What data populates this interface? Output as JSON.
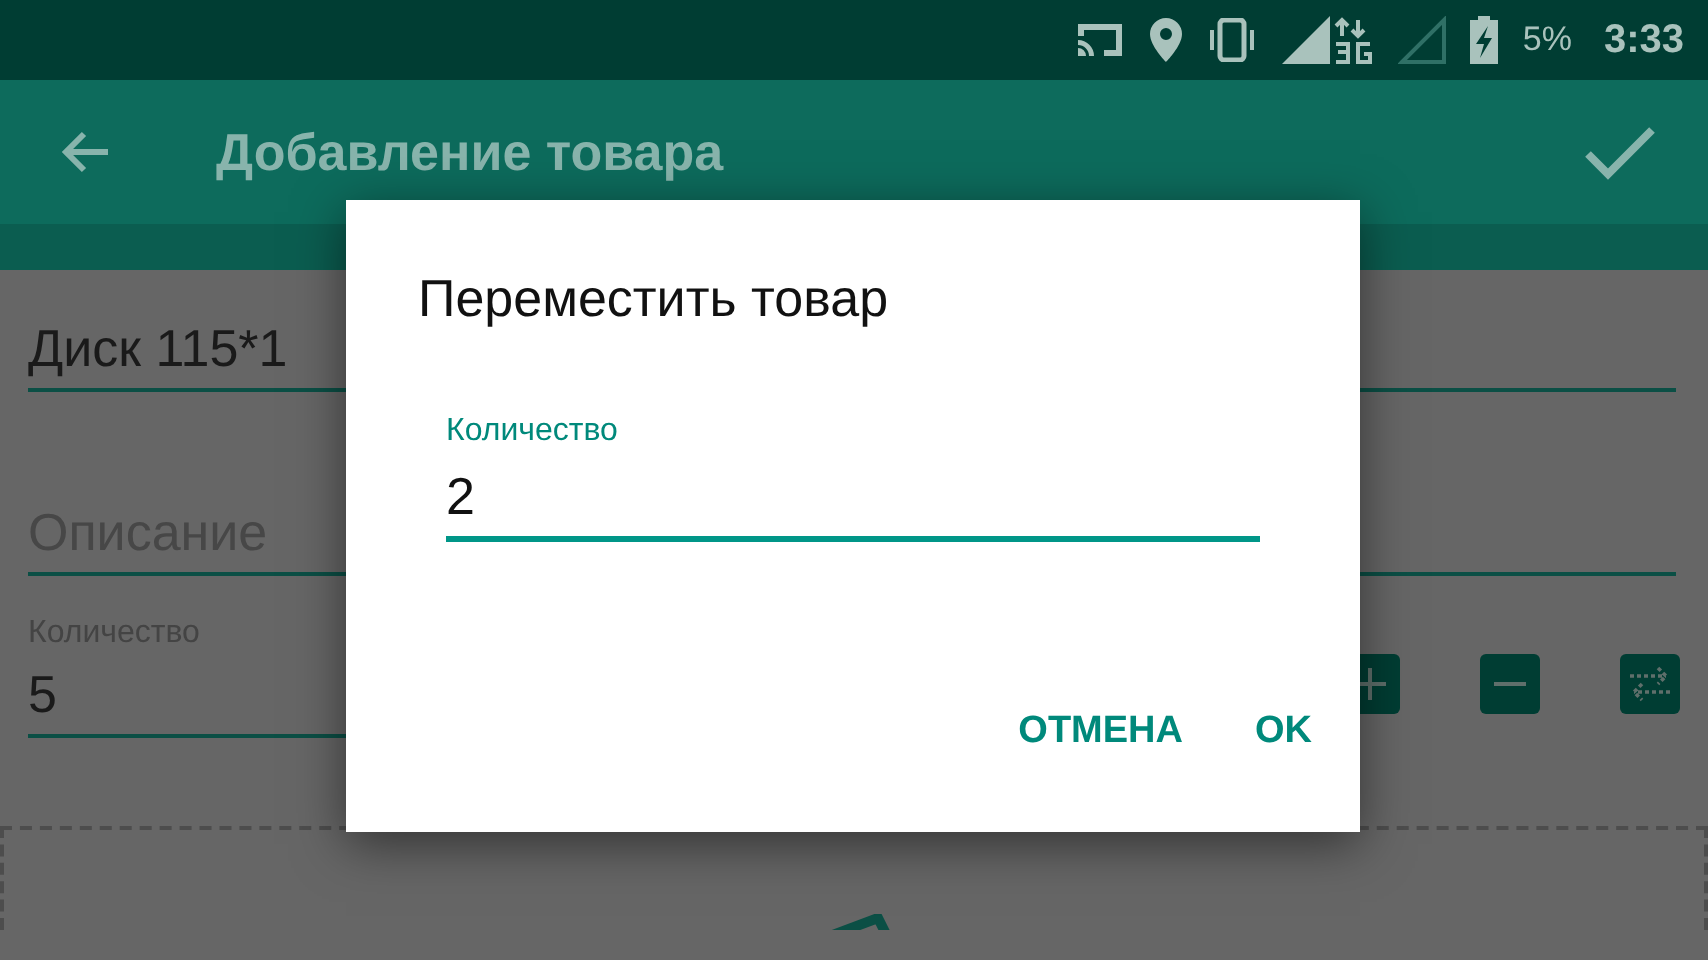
{
  "status_bar": {
    "battery": "5%",
    "time": "3:33"
  },
  "app_bar": {
    "title": "Добавление товара"
  },
  "form": {
    "name": {
      "value": "Диск 115*1"
    },
    "description": {
      "placeholder": "Описание"
    },
    "quantity": {
      "label": "Количество",
      "value": "5"
    }
  },
  "dialog": {
    "title": "Переместить товар",
    "field": {
      "label": "Количество",
      "value": "2"
    },
    "buttons": [
      {
        "label": "ОТМЕНА"
      },
      {
        "label": "OK"
      }
    ]
  }
}
